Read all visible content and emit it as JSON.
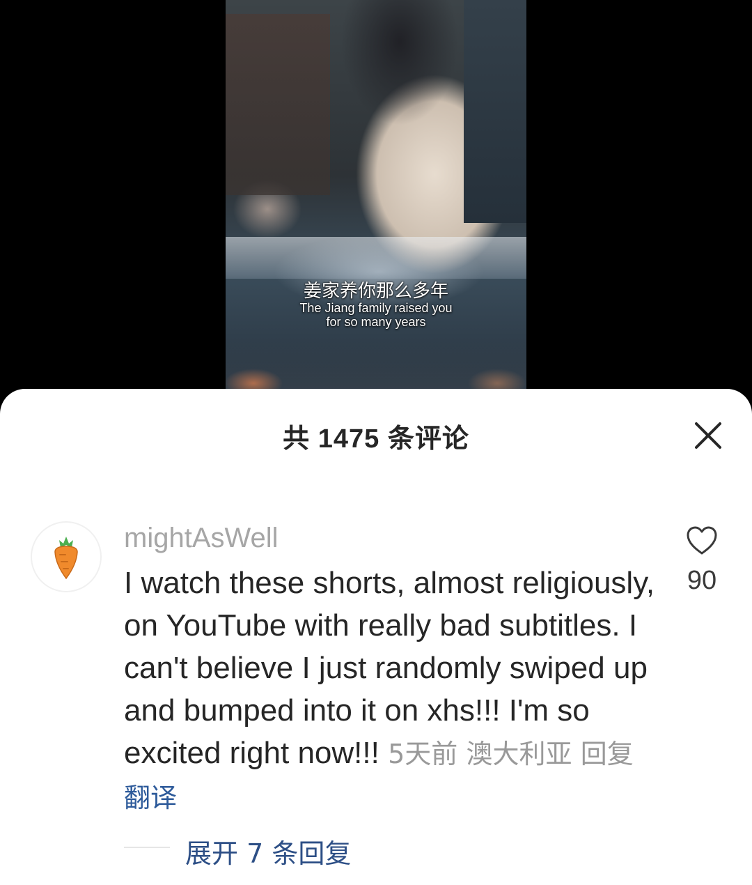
{
  "video": {
    "subtitle_cn": "姜家养你那么多年",
    "subtitle_en_line1": "The Jiang family raised you",
    "subtitle_en_line2": "for so many years"
  },
  "comments_panel": {
    "title": "共 1475 条评论",
    "close_icon": "close-icon"
  },
  "comment": {
    "avatar_icon": "carrot-avatar-icon",
    "username": "mightAsWell",
    "text": "I watch these shorts, almost religiously, on YouTube with really bad subtitles. I can't believe I just randomly swiped up and bumped into it on xhs!!! I'm so excited right now!!!",
    "time": "5天前",
    "location": "澳大利亚",
    "reply_label": "回复",
    "translate_label": "翻译",
    "like_icon": "heart-icon",
    "like_count": "90",
    "expand_replies": "展开 7 条回复"
  },
  "colors": {
    "username": "#a6a6a6",
    "translate_link": "#2d5a9a",
    "expand_link": "#2d4f86",
    "carrot": "#f08a2c",
    "carrot_leaf": "#4caf50"
  }
}
